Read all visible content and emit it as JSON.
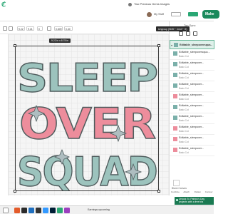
{
  "header": {
    "project_title": "Two Precious Gems Images",
    "my_stuff": "My Stuff",
    "make_label": "Make"
  },
  "toolbar": {
    "width_label": "W",
    "height_label": "H",
    "width_value": "9.22",
    "height_value": "9.21",
    "rotate_value": "0",
    "x_value": "0.609",
    "y_value": "0.40"
  },
  "canvas": {
    "dimension_tag": "9.22 in x 8.78 in",
    "artwork_words": [
      "SLEEP",
      "OVER",
      "SQUAD"
    ],
    "colors": {
      "teal": "#9cc3bd",
      "pink": "#ed8d9c",
      "outline": "#4e5b5c",
      "sparkle": "#aebdc0"
    }
  },
  "right_panel": {
    "tab_label": "Ton Sync",
    "tooltip": "Ungroup (Shift + Cmd + G)",
    "group_name": "Editable_sleepoversqua...",
    "layers": [
      {
        "name": "Editable_sleepoversqua...",
        "sub": "Basic Cut",
        "color": "#7bb0aa"
      },
      {
        "name": "Editable_sleepover...",
        "sub": "Basic Cut",
        "color": "#7bb0aa"
      },
      {
        "name": "Editable_sleepover...",
        "sub": "Basic Cut",
        "color": "#7bb0aa"
      },
      {
        "name": "Editable_sleepover...",
        "sub": "Basic Cut",
        "color": "#7bb0aa"
      },
      {
        "name": "Editable_sleepover...",
        "sub": "Basic Cut",
        "color": "#ed8d9c"
      },
      {
        "name": "Editable_sleepover...",
        "sub": "Basic Cut",
        "color": "#7bb0aa"
      },
      {
        "name": "Editable_sleepover...",
        "sub": "Basic Cut",
        "color": "#7bb0aa"
      },
      {
        "name": "Editable_sleepover...",
        "sub": "Basic Cut",
        "color": "#ed8d9c"
      },
      {
        "name": "Editable_sleepover...",
        "sub": "Basic Cut",
        "color": "#ed8d9c"
      },
      {
        "name": "Editable_sleepover...",
        "sub": "Basic Cut",
        "color": "#ed8d9c"
      }
    ],
    "blank_canvas_label": "Blank Canvas",
    "bottom_actions": [
      "Combine",
      "Attach",
      "Flatten",
      "Contour"
    ]
  },
  "notification": {
    "line1": "Unlock St. Patrick's Day",
    "line2": "projects with a free tria"
  },
  "taskbar": {
    "earnings_text": "Earnings upcoming"
  }
}
